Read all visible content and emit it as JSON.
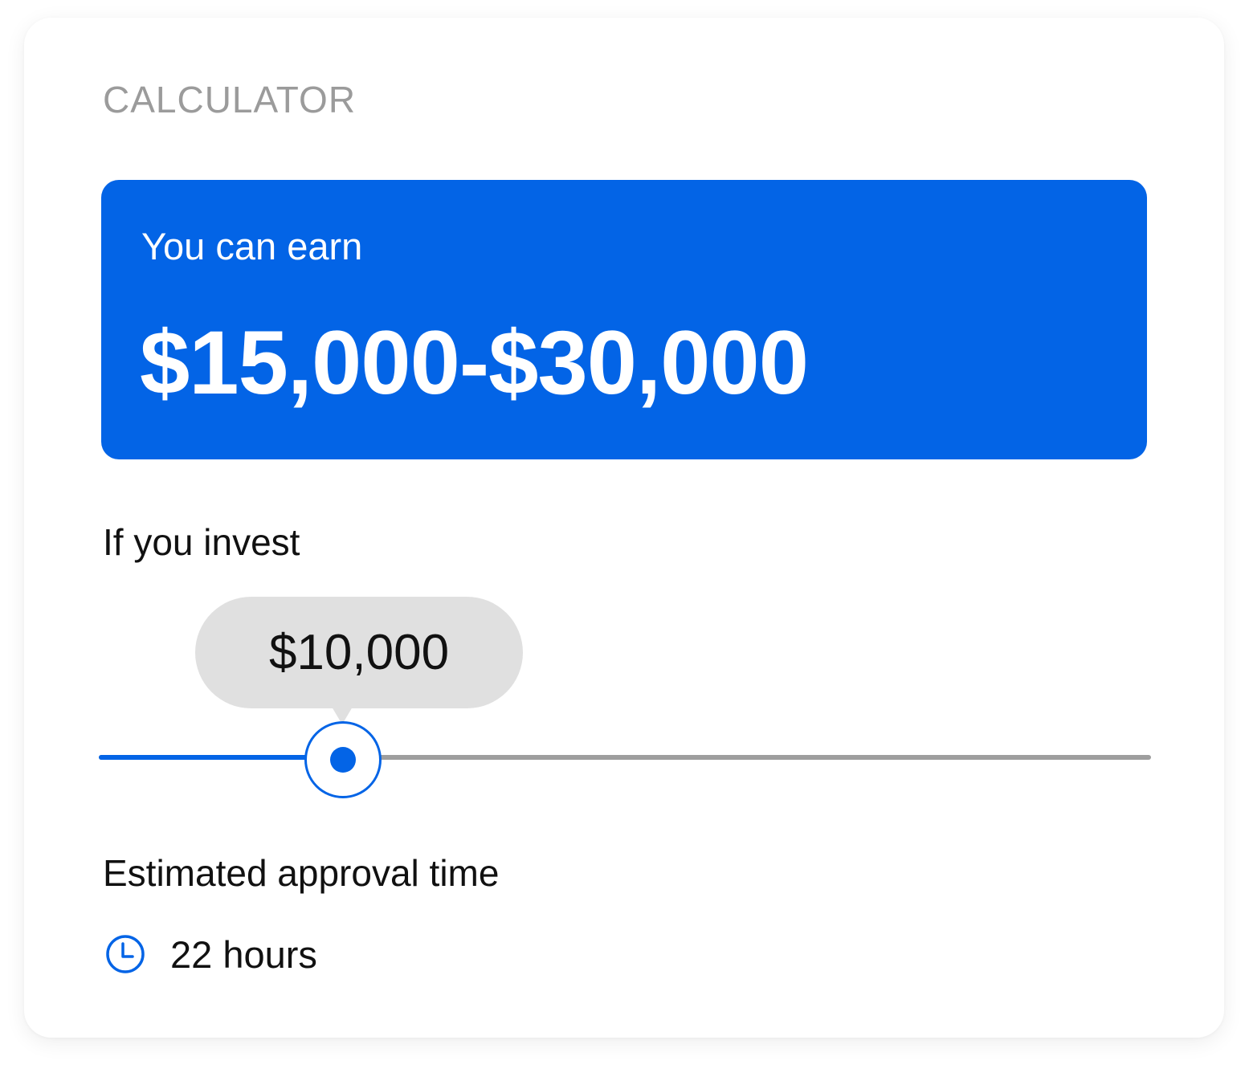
{
  "calculator": {
    "kicker": "CALCULATOR",
    "earn": {
      "label": "You can earn",
      "value": "$15,000-$30,000"
    },
    "invest": {
      "label": "If you invest",
      "amount": "$10,000",
      "slider_fraction": 0.232
    },
    "approval": {
      "label": "Estimated approval time",
      "value": "22 hours",
      "icon": "clock-icon"
    }
  },
  "colors": {
    "accent": "#0364e6",
    "track_inactive": "#9e9e9e",
    "tooltip_bg": "#e0e0e0",
    "muted_text": "#9b9b9b",
    "text": "#111111"
  }
}
